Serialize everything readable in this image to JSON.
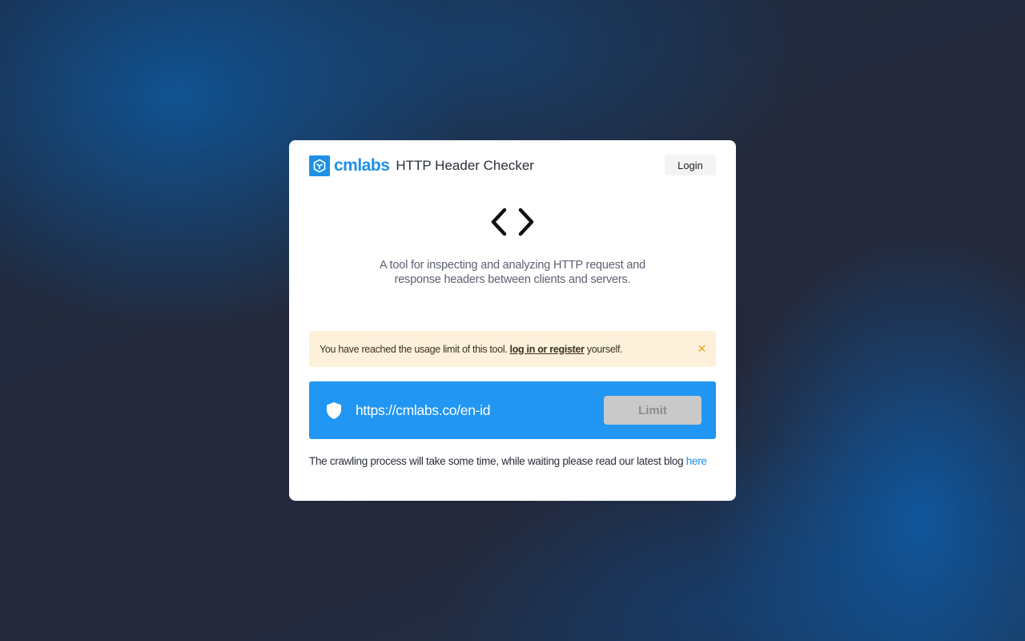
{
  "header": {
    "brand": "cmlabs",
    "tool_title": "HTTP Header Checker",
    "login_label": "Login"
  },
  "hero": {
    "icon": "code-brackets-icon",
    "description": "A tool for inspecting and analyzing HTTP request and response headers between clients and servers."
  },
  "alert": {
    "text_before": "You have reached the usage limit of this tool.",
    "link_text": "log in or register",
    "text_after": "yourself.",
    "close_symbol": "✕",
    "color": "#fdf1dc"
  },
  "url_bar": {
    "value": "https://cmlabs.co/en-id",
    "button_label": "Limit",
    "color": "#2196f3"
  },
  "footer": {
    "text": "The crawling process will take some time, while waiting please read our latest blog",
    "link_text": "here"
  },
  "colors": {
    "brand": "#1e90e6",
    "accent": "#2196f3"
  }
}
